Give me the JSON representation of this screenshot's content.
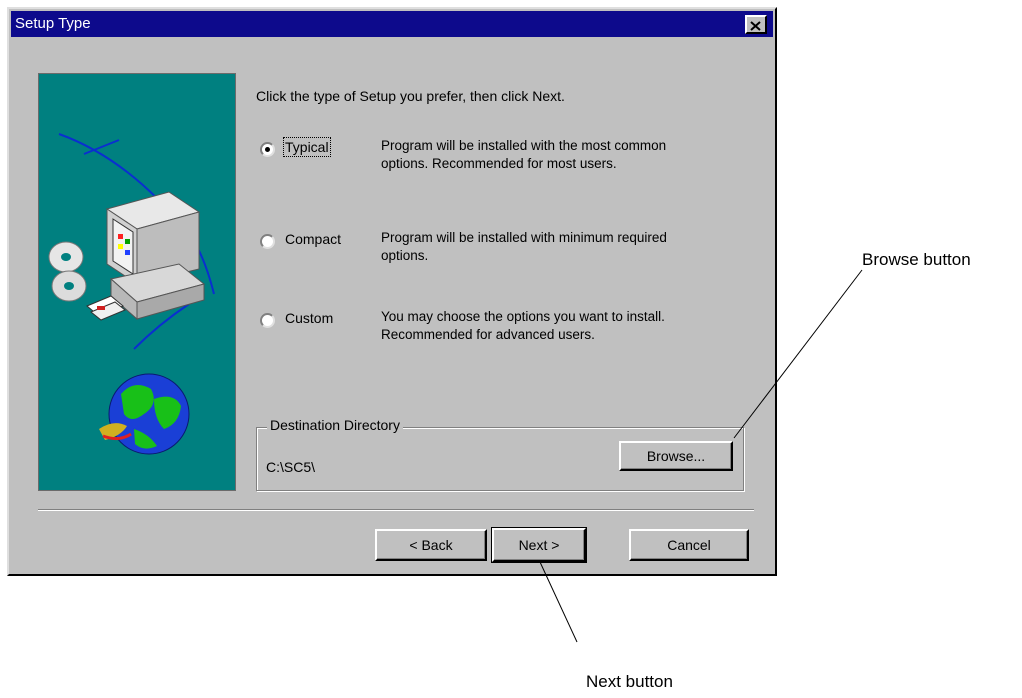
{
  "window": {
    "title": "Setup Type"
  },
  "instruction": "Click the type of Setup you prefer, then click Next.",
  "options": [
    {
      "label": "Typical",
      "selected": true,
      "description_line1": "Program will be installed with the most common",
      "description_line2": "options. Recommended for most users."
    },
    {
      "label": "Compact",
      "selected": false,
      "description_line1": "Program will be installed with minimum required",
      "description_line2": "options."
    },
    {
      "label": "Custom",
      "selected": false,
      "description_line1": "You may choose the options you want to install.",
      "description_line2": "Recommended for advanced users."
    }
  ],
  "destination": {
    "legend": "Destination Directory",
    "path": "C:\\SC5\\",
    "browse_label": "Browse..."
  },
  "buttons": {
    "back": "< Back",
    "next": "Next >",
    "cancel": "Cancel"
  },
  "annotations": {
    "browse": "Browse button",
    "next": "Next button"
  },
  "colors": {
    "titlebar": "#0d0a8c",
    "dialog_face": "#c0c0c0",
    "art_background": "#008080"
  },
  "icons": {
    "close": "close-icon",
    "setup_art": "computer-globe-illustration"
  }
}
